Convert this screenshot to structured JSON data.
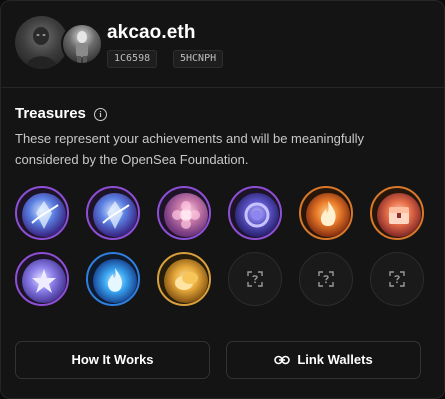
{
  "profile": {
    "username": "akcao.eth",
    "tags": [
      "1C6598",
      "5HCNPH"
    ]
  },
  "treasures": {
    "title": "Treasures",
    "description": "These represent your achievements and will be meaningfully considered by the OpenSea Foundation.",
    "badges": [
      {
        "state": "earned",
        "ring": "purple",
        "icon": "crystal-badge-icon"
      },
      {
        "state": "earned",
        "ring": "purple",
        "icon": "crystal-badge-icon"
      },
      {
        "state": "earned",
        "ring": "purple",
        "icon": "flower-badge-icon"
      },
      {
        "state": "earned",
        "ring": "purple",
        "icon": "orb-badge-icon"
      },
      {
        "state": "earned",
        "ring": "orange",
        "icon": "flame-badge-icon"
      },
      {
        "state": "earned",
        "ring": "orange",
        "icon": "chest-badge-icon"
      },
      {
        "state": "earned",
        "ring": "purple",
        "icon": "star-badge-icon"
      },
      {
        "state": "earned",
        "ring": "blue",
        "icon": "blue-flame-badge-icon"
      },
      {
        "state": "earned",
        "ring": "gold",
        "icon": "coin-badge-icon"
      },
      {
        "state": "locked",
        "ring": "none",
        "icon": "unknown-badge-icon"
      },
      {
        "state": "locked",
        "ring": "none",
        "icon": "unknown-badge-icon"
      },
      {
        "state": "locked",
        "ring": "none",
        "icon": "unknown-badge-icon"
      }
    ]
  },
  "actions": {
    "how_it_works": "How It Works",
    "link_wallets": "Link Wallets"
  },
  "colors": {
    "background": "#141414",
    "border": "#262626",
    "ring_purple": "#8e4fd6",
    "ring_blue": "#2f7fe0",
    "ring_gold": "#d9a03c",
    "ring_orange": "#d9782a"
  }
}
